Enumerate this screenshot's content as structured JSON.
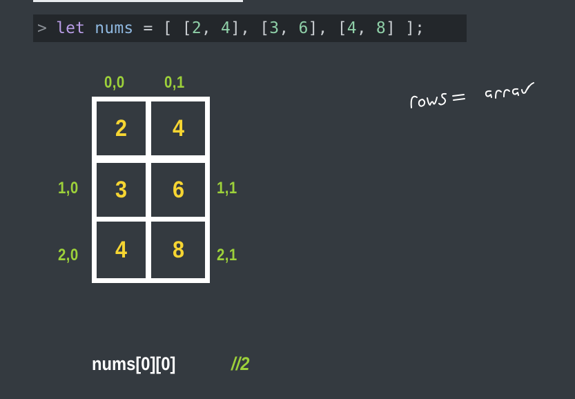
{
  "code": {
    "prompt": ">",
    "keyword": "let",
    "variable": "nums",
    "operator": "=",
    "value": "[ [2, 4], [3, 6], [4, 8] ];",
    "tokens": [
      {
        "t": "[ ",
        "c": "punc"
      },
      {
        "t": "[",
        "c": "punc"
      },
      {
        "t": "2",
        "c": "num"
      },
      {
        "t": ", ",
        "c": "punc"
      },
      {
        "t": "4",
        "c": "num"
      },
      {
        "t": "], ",
        "c": "punc"
      },
      {
        "t": "[",
        "c": "punc"
      },
      {
        "t": "3",
        "c": "num"
      },
      {
        "t": ", ",
        "c": "punc"
      },
      {
        "t": "6",
        "c": "num"
      },
      {
        "t": "], ",
        "c": "punc"
      },
      {
        "t": "[",
        "c": "punc"
      },
      {
        "t": "4",
        "c": "num"
      },
      {
        "t": ", ",
        "c": "punc"
      },
      {
        "t": "8",
        "c": "num"
      },
      {
        "t": "] ];",
        "c": "punc"
      }
    ]
  },
  "grid": {
    "col_labels": [
      "0,0",
      "0,1"
    ],
    "left_labels": [
      "1,0",
      "2,0"
    ],
    "right_labels": [
      "1,1",
      "2,1"
    ],
    "cells": [
      [
        "2",
        "4"
      ],
      [
        "3",
        "6"
      ],
      [
        "4",
        "8"
      ]
    ]
  },
  "handwritten_note": "rows = array",
  "expression": "nums[0][0]",
  "comment": "//2",
  "colors": {
    "background": "#343a40",
    "code_bar": "#23272b",
    "label_green": "#9dd13a",
    "cell_value_yellow": "#f6d532",
    "grid_border": "#ffffff"
  }
}
